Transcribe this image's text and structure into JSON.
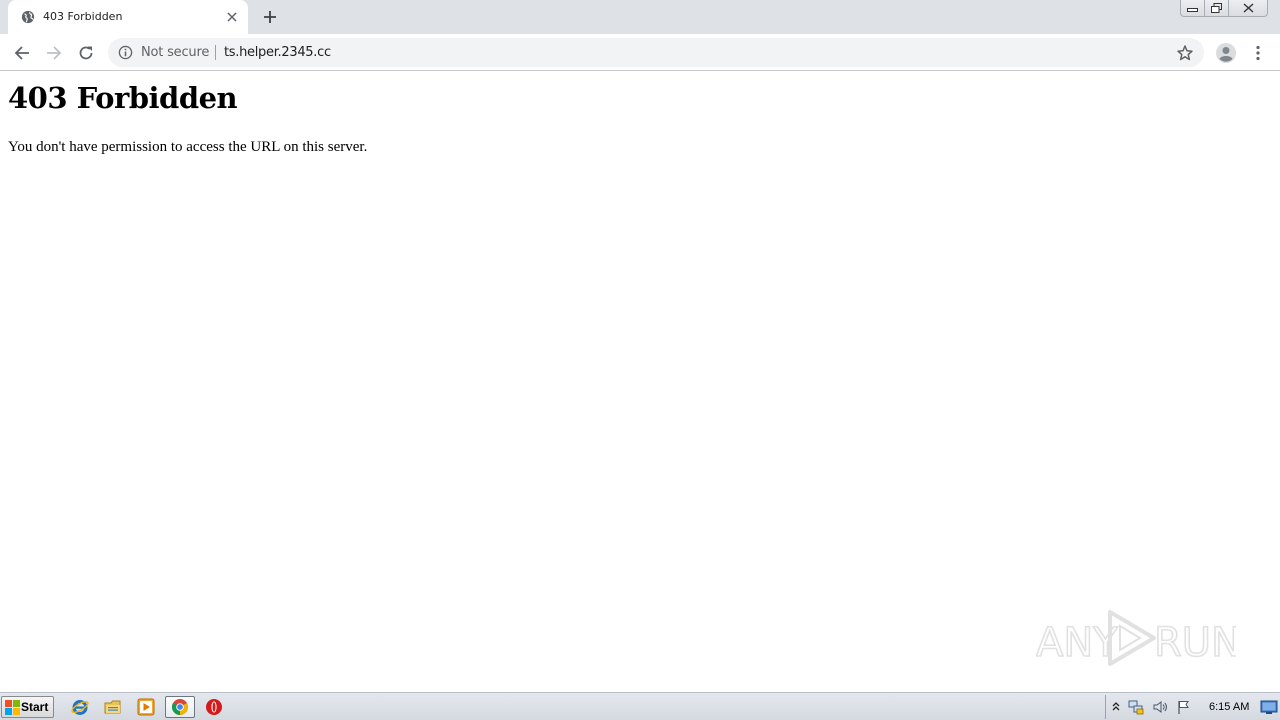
{
  "browser": {
    "tab": {
      "title": "403 Forbidden",
      "favicon": "globe-icon"
    },
    "omnibox": {
      "security_label": "Not secure",
      "url": "ts.helper.2345.cc"
    },
    "accent": "#5f6368"
  },
  "page": {
    "heading": "403 Forbidden",
    "message": "You don't have permission to access the URL on this server."
  },
  "watermark": {
    "left_text": "ANY",
    "right_text": "RUN"
  },
  "taskbar": {
    "start_label": "Start",
    "pinned": [
      "internet-explorer-icon",
      "file-explorer-icon",
      "media-player-icon",
      "chrome-icon",
      "opera-icon"
    ],
    "clock": "6:15 AM"
  }
}
